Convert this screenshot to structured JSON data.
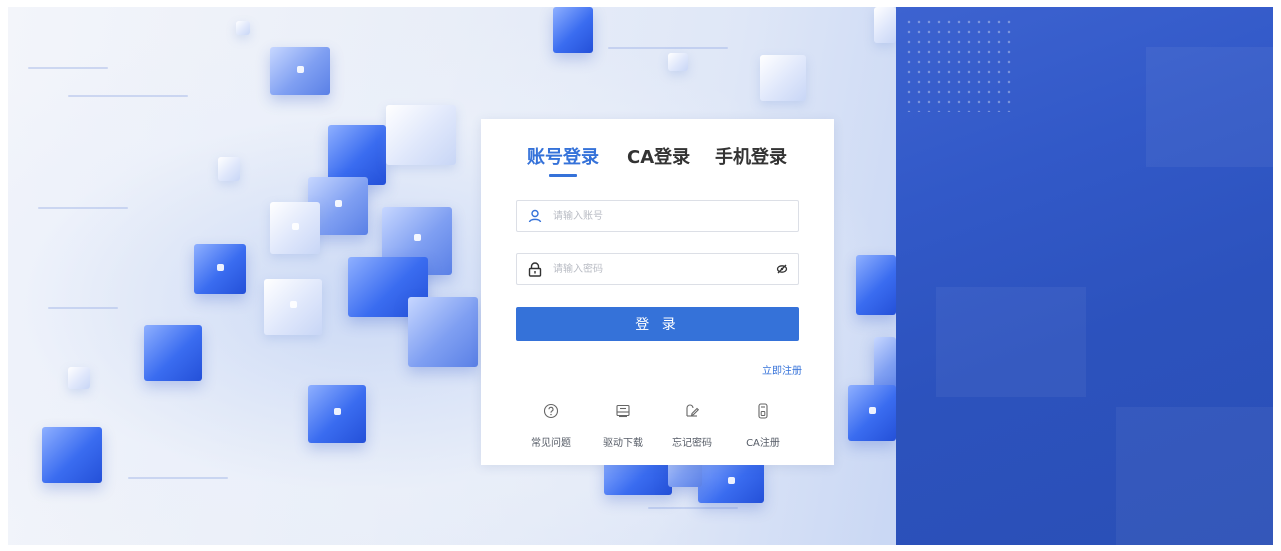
{
  "login_tabs": [
    {
      "label": "账号登录",
      "active": true
    },
    {
      "label": "CA登录",
      "active": false
    },
    {
      "label": "手机登录",
      "active": false
    }
  ],
  "account_input": {
    "placeholder": "请输入账号",
    "icon": "user-icon"
  },
  "password_input": {
    "placeholder": "请输入密码",
    "icon": "lock-icon",
    "toggle_icon": "eye-hidden-icon"
  },
  "login_button": {
    "label": "登 录"
  },
  "register_link": {
    "label": "立即注册"
  },
  "quick_links": [
    {
      "label": "常见问题",
      "icon": "question-icon"
    },
    {
      "label": "驱动下载",
      "icon": "download-box-icon"
    },
    {
      "label": "忘记密码",
      "icon": "edit-icon"
    },
    {
      "label": "CA注册",
      "icon": "usb-key-icon"
    }
  ],
  "colors": {
    "primary": "#3572d9",
    "right_panel": "#3259c8",
    "text": "#333333"
  }
}
